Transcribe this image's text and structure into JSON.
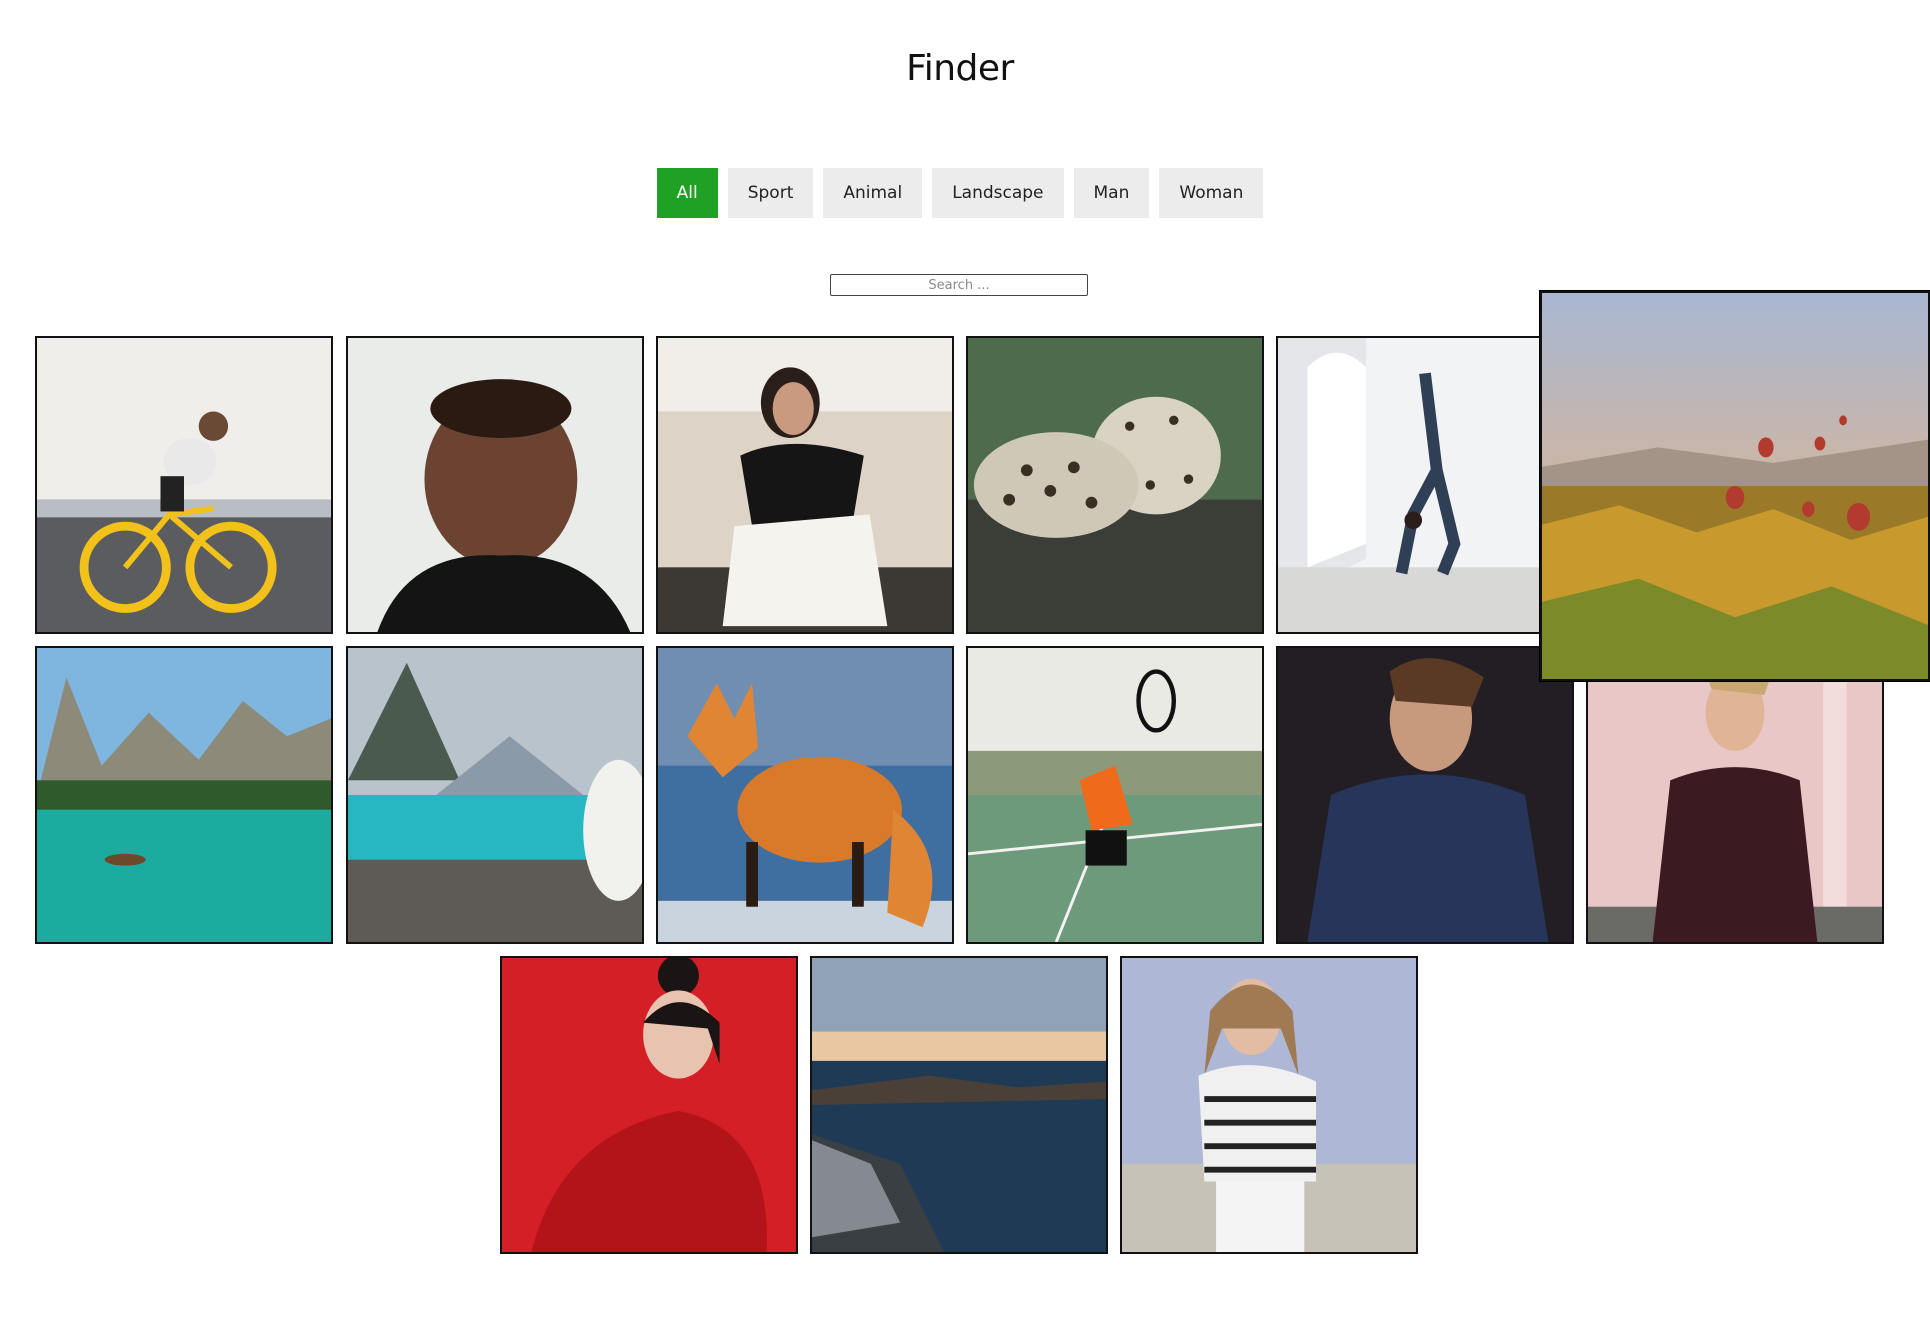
{
  "header": {
    "title": "Finder"
  },
  "filters": [
    {
      "label": "All",
      "active": true
    },
    {
      "label": "Sport",
      "active": false
    },
    {
      "label": "Animal",
      "active": false
    },
    {
      "label": "Landscape",
      "active": false
    },
    {
      "label": "Man",
      "active": false
    },
    {
      "label": "Woman",
      "active": false
    }
  ],
  "search": {
    "placeholder": "Search ...",
    "value": ""
  },
  "colors": {
    "accent": "#1fa126",
    "button_bg": "#ececec",
    "frame": "#111111"
  },
  "gallery": {
    "items": [
      {
        "category": "sport",
        "subject": "cyclist"
      },
      {
        "category": "man",
        "subject": "portrait-man-turtleneck"
      },
      {
        "category": "woman",
        "subject": "woman-on-sofa"
      },
      {
        "category": "animal",
        "subject": "leopard"
      },
      {
        "category": "sport",
        "subject": "gymnast-handstand"
      },
      {
        "category": "landscape",
        "subject": "hot-air-balloons",
        "hovered": true
      },
      {
        "category": "landscape",
        "subject": "mountain-lake-boat"
      },
      {
        "category": "animal",
        "subject": "dog-at-lake"
      },
      {
        "category": "animal",
        "subject": "fox"
      },
      {
        "category": "sport",
        "subject": "tennis-player"
      },
      {
        "category": "man",
        "subject": "man-in-suit"
      },
      {
        "category": "man",
        "subject": "man-in-sweater"
      },
      {
        "category": "woman",
        "subject": "woman-in-red"
      },
      {
        "category": "landscape",
        "subject": "rocky-coast-sunset"
      },
      {
        "category": "woman",
        "subject": "woman-striped-sweater"
      }
    ]
  }
}
